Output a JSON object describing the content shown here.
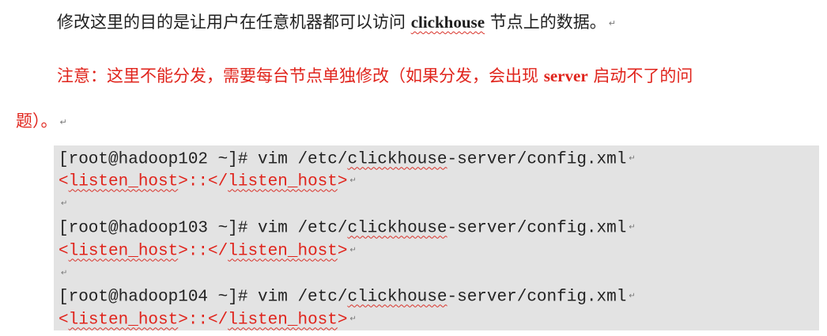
{
  "paragraphs": {
    "p1": {
      "before": "修改这里的目的是让用户在任意机器都可以访问 ",
      "keyword": "clickhouse",
      "after": " 节点上的数据。"
    },
    "p2": {
      "before": "注意：这里不能分发，需要每台节点单独修改（如果分发，会出现 ",
      "keyword": "server",
      "after": " 启动不了的问"
    },
    "p3": {
      "text": "题）。"
    }
  },
  "code_block": {
    "lines": [
      {
        "type": "command",
        "prompt": "[root@hadoop102 ~]# vim /etc/",
        "word": "clickhouse",
        "rest": "-server/config.xml"
      },
      {
        "type": "xml",
        "open_lt": "<",
        "open_tag": "listen_host",
        "middle": ">::</",
        "close_tag": "listen_host",
        "close_gt": ">"
      },
      {
        "type": "blank"
      },
      {
        "type": "command",
        "prompt": "[root@hadoop103 ~]# vim /etc/",
        "word": "clickhouse",
        "rest": "-server/config.xml"
      },
      {
        "type": "xml",
        "open_lt": "<",
        "open_tag": "listen_host",
        "middle": ">::</",
        "close_tag": "listen_host",
        "close_gt": ">"
      },
      {
        "type": "blank"
      },
      {
        "type": "command",
        "prompt": "[root@hadoop104 ~]# vim /etc/",
        "word": "clickhouse",
        "rest": "-server/config.xml"
      },
      {
        "type": "xml",
        "open_lt": "<",
        "open_tag": "listen_host",
        "middle": ">::</",
        "close_tag": "listen_host",
        "close_gt": ">"
      }
    ]
  },
  "paragraph_mark": "↵",
  "colors": {
    "body_text": "#1f1f1f",
    "warning_text": "#e0241c",
    "code_background": "#e3e3e3",
    "spellcheck_underline": "#d9322a"
  }
}
